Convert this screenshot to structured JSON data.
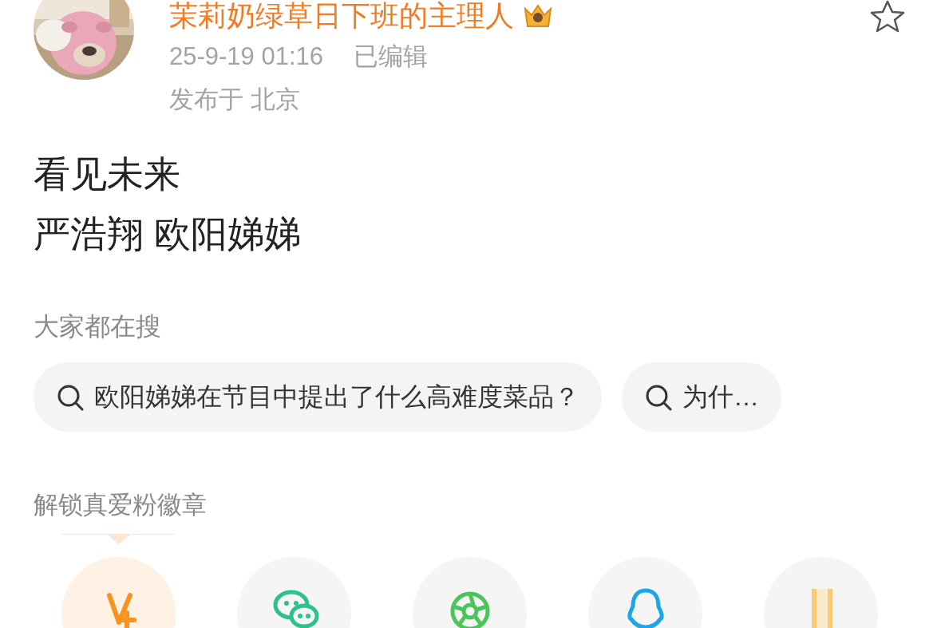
{
  "post": {
    "author": "茉莉奶绿草日下班的主理人",
    "timestamp": "25-9-19 01:16",
    "edited": "已编辑",
    "location": "发布于 北京",
    "favorited": false,
    "lines": [
      "看见未来",
      "严浩翔 欧阳娣娣"
    ]
  },
  "trending": {
    "title": "大家都在搜",
    "queries": [
      {
        "text": "欧阳娣娣在节目中提出了什么高难度菜品？"
      },
      {
        "text": "为什…"
      }
    ]
  },
  "badges": {
    "title": "解锁真爱粉徽章",
    "items": [
      {
        "kind": "vplus",
        "selected": true
      },
      {
        "kind": "wechat",
        "selected": false
      },
      {
        "kind": "aperture",
        "selected": false
      },
      {
        "kind": "qq",
        "selected": false
      },
      {
        "kind": "bars",
        "selected": false
      }
    ]
  }
}
